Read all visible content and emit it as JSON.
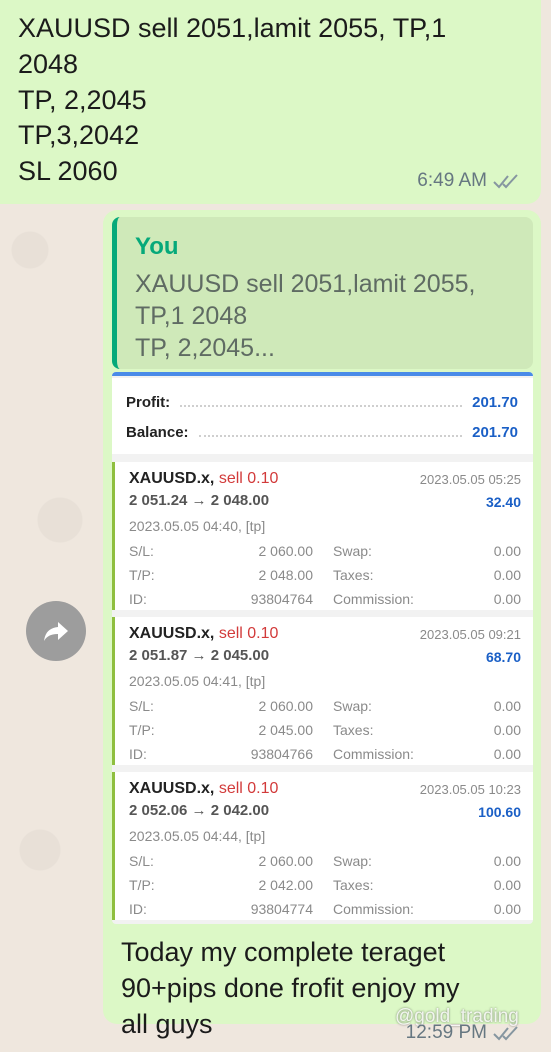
{
  "message1": {
    "lines": [
      "XAUUSD sell 2051,lamit 2055, TP,1",
      "2048",
      "TP, 2,2045",
      "TP,3,2042",
      "SL 2060"
    ],
    "time": "6:49 AM"
  },
  "message2": {
    "quote": {
      "author": "You",
      "lines": [
        "XAUUSD sell 2051,lamit 2055,",
        "TP,1 2048",
        "TP, 2,2045..."
      ]
    },
    "summary": {
      "profit_label": "Profit:",
      "profit_value": "201.70",
      "balance_label": "Balance:",
      "balance_value": "201.70"
    },
    "deals": [
      {
        "symbol": "XAUUSD.x,",
        "side": "sell 0.10",
        "close_time": "2023.05.05 05:25",
        "prices": "2 051.24 → 2 048.00",
        "profit": "32.40",
        "open_time": "2023.05.05 04:40, [tp]",
        "sl_label": "S/L:",
        "sl": "2 060.00",
        "tp_label": "T/P:",
        "tp": "2 048.00",
        "id_label": "ID:",
        "id": "93804764",
        "swap_label": "Swap:",
        "swap": "0.00",
        "taxes_label": "Taxes:",
        "taxes": "0.00",
        "commission_label": "Commission:",
        "commission": "0.00"
      },
      {
        "symbol": "XAUUSD.x,",
        "side": "sell 0.10",
        "close_time": "2023.05.05 09:21",
        "prices": "2 051.87 → 2 045.00",
        "profit": "68.70",
        "open_time": "2023.05.05 04:41, [tp]",
        "sl_label": "S/L:",
        "sl": "2 060.00",
        "tp_label": "T/P:",
        "tp": "2 045.00",
        "id_label": "ID:",
        "id": "93804766",
        "swap_label": "Swap:",
        "swap": "0.00",
        "taxes_label": "Taxes:",
        "taxes": "0.00",
        "commission_label": "Commission:",
        "commission": "0.00"
      },
      {
        "symbol": "XAUUSD.x,",
        "side": "sell 0.10",
        "close_time": "2023.05.05 10:23",
        "prices": "2 052.06 → 2 042.00",
        "profit": "100.60",
        "open_time": "2023.05.05 04:44, [tp]",
        "sl_label": "S/L:",
        "sl": "2 060.00",
        "tp_label": "T/P:",
        "tp": "2 042.00",
        "id_label": "ID:",
        "id": "93804774",
        "swap_label": "Swap:",
        "swap": "0.00",
        "taxes_label": "Taxes:",
        "taxes": "0.00",
        "commission_label": "Commission:",
        "commission": "0.00"
      }
    ],
    "text_lines": [
      "Today my complete teraget",
      "90+pips done frofit enjoy my",
      "all guys"
    ],
    "watermark": "@gold_trading",
    "time": "12:59 PM"
  },
  "icons": {
    "forward": "forward-arrow-icon",
    "read_receipt": "double-check-icon"
  },
  "colors": {
    "bubble": "#dcf8c6",
    "quote_accent": "#06a97a",
    "sell": "#d23a3a",
    "profit": "#1a5fc6",
    "read_tick": "#667781"
  }
}
